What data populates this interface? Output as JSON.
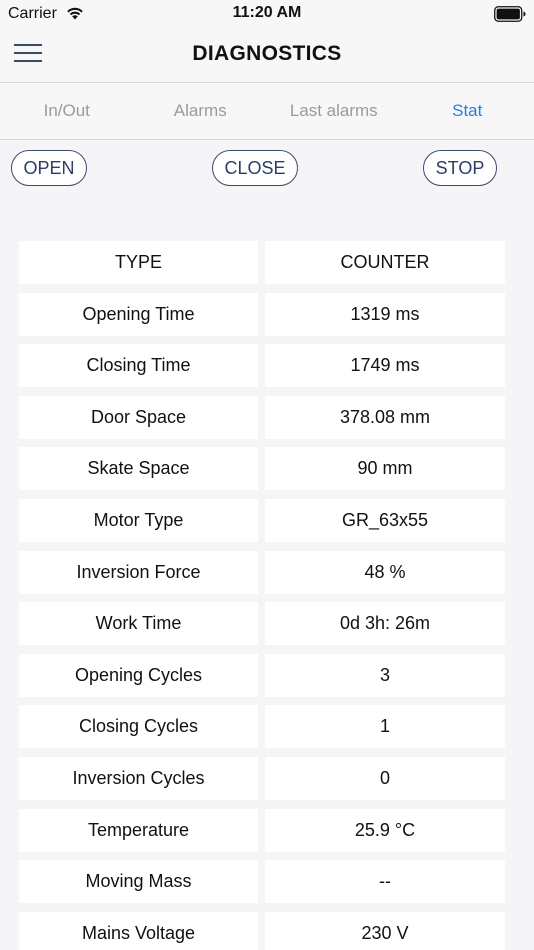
{
  "status_bar": {
    "carrier": "Carrier",
    "time": "11:20 AM"
  },
  "header": {
    "title": "DIAGNOSTICS"
  },
  "tabs": [
    {
      "label": "In/Out",
      "active": false
    },
    {
      "label": "Alarms",
      "active": false
    },
    {
      "label": "Last alarms",
      "active": false
    },
    {
      "label": "Stat",
      "active": true
    }
  ],
  "actions": {
    "open_label": "OPEN",
    "close_label": "CLOSE",
    "stop_label": "STOP"
  },
  "table": {
    "headers": [
      "TYPE",
      "COUNTER"
    ],
    "rows": [
      {
        "type": "Opening Time",
        "value": "1319 ms"
      },
      {
        "type": "Closing Time",
        "value": "1749 ms"
      },
      {
        "type": "Door Space",
        "value": "378.08 mm"
      },
      {
        "type": "Skate Space",
        "value": "90 mm"
      },
      {
        "type": "Motor Type",
        "value": "GR_63x55"
      },
      {
        "type": "Inversion Force",
        "value": "48 %"
      },
      {
        "type": "Work Time",
        "value": "0d 3h: 26m"
      },
      {
        "type": "Opening Cycles",
        "value": "3"
      },
      {
        "type": "Closing Cycles",
        "value": "1"
      },
      {
        "type": "Inversion Cycles",
        "value": "0"
      },
      {
        "type": "Temperature",
        "value": "25.9 °C"
      },
      {
        "type": "Moving Mass",
        "value": "--"
      },
      {
        "type": "Mains Voltage",
        "value": "230 V"
      }
    ]
  },
  "colors": {
    "accent": "#2a80d8",
    "button_border": "#3a4a6b",
    "inactive_tab": "#9a9a9f",
    "background": "#f5f5f7"
  },
  "icons": {
    "wifi": "wifi-icon",
    "battery": "battery-icon",
    "menu": "hamburger-menu-icon"
  }
}
